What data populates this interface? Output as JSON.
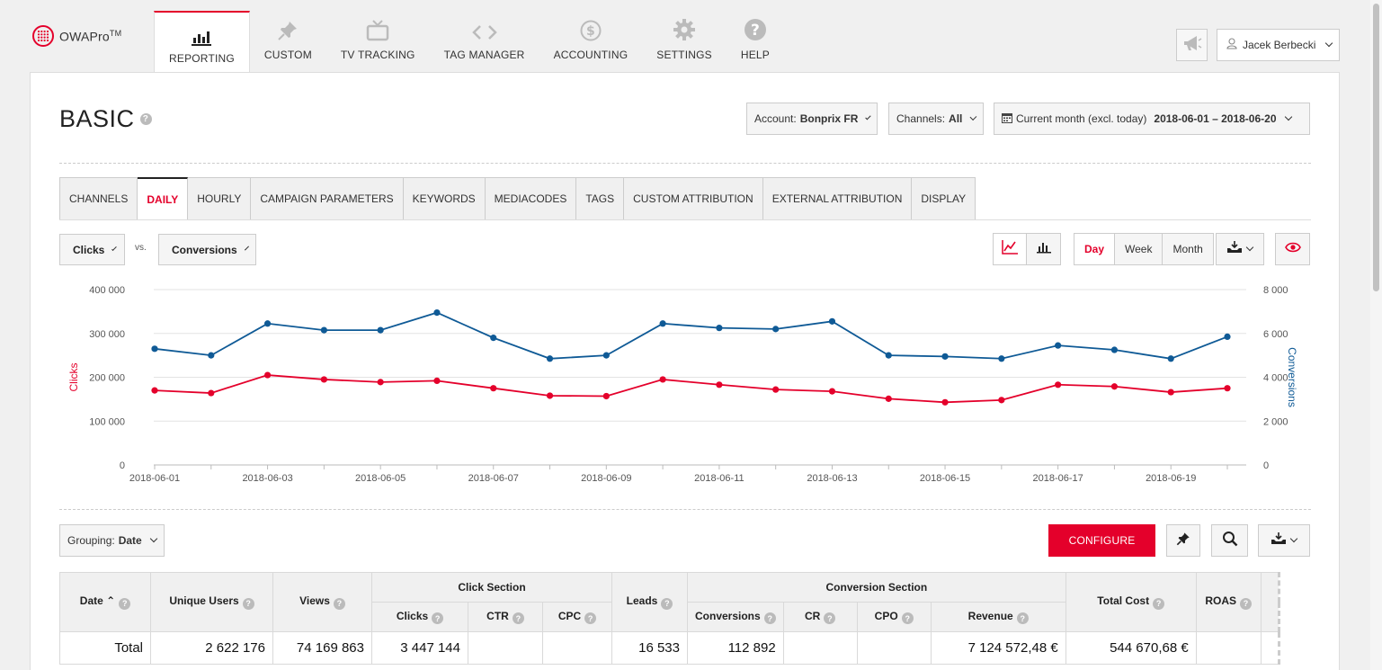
{
  "app": {
    "logo_text": "OWAPro",
    "logo_suffix": "TM"
  },
  "nav": [
    {
      "label": "REPORTING",
      "icon": "bar-chart-icon",
      "active": true
    },
    {
      "label": "CUSTOM",
      "icon": "pin-icon"
    },
    {
      "label": "TV TRACKING",
      "icon": "tv-icon"
    },
    {
      "label": "TAG MANAGER",
      "icon": "code-icon"
    },
    {
      "label": "ACCOUNTING",
      "icon": "dollar-icon"
    },
    {
      "label": "SETTINGS",
      "icon": "gear-icon"
    },
    {
      "label": "HELP",
      "icon": "question-icon"
    }
  ],
  "user": {
    "name": "Jacek Berbecki"
  },
  "page": {
    "title": "BASIC"
  },
  "filters": {
    "account_label": "Account:",
    "account_value": "Bonprix FR",
    "channels_label": "Channels:",
    "channels_value": "All",
    "date_label": "Current month (excl. today)",
    "date_value": "2018-06-01 – 2018-06-20"
  },
  "tabs": [
    "CHANNELS",
    "DAILY",
    "HOURLY",
    "CAMPAIGN PARAMETERS",
    "KEYWORDS",
    "MEDIACODES",
    "TAGS",
    "CUSTOM ATTRIBUTION",
    "EXTERNAL ATTRIBUTION",
    "DISPLAY"
  ],
  "active_tab": "DAILY",
  "metric_left": "Clicks",
  "vs_label": "vs.",
  "metric_right": "Conversions",
  "granularity": [
    "Day",
    "Week",
    "Month"
  ],
  "colors": {
    "accent": "#e4002b",
    "clicks": "#e4002b",
    "conversions": "#0f5a96"
  },
  "chart_data": {
    "type": "line",
    "x": [
      "2018-06-01",
      "2018-06-02",
      "2018-06-03",
      "2018-06-04",
      "2018-06-05",
      "2018-06-06",
      "2018-06-07",
      "2018-06-08",
      "2018-06-09",
      "2018-06-10",
      "2018-06-11",
      "2018-06-12",
      "2018-06-13",
      "2018-06-14",
      "2018-06-15",
      "2018-06-16",
      "2018-06-17",
      "2018-06-18",
      "2018-06-19",
      "2018-06-20"
    ],
    "x_tick_labels": [
      "2018-06-01",
      "2018-06-03",
      "2018-06-05",
      "2018-06-07",
      "2018-06-09",
      "2018-06-11",
      "2018-06-13",
      "2018-06-15",
      "2018-06-17",
      "2018-06-19"
    ],
    "series": [
      {
        "name": "Clicks",
        "axis": "left",
        "color": "#e4002b",
        "values": [
          170000,
          164000,
          205000,
          195000,
          189000,
          192000,
          175000,
          158000,
          157000,
          195000,
          183000,
          172000,
          168000,
          151000,
          143000,
          148000,
          183000,
          179000,
          166000,
          175000
        ]
      },
      {
        "name": "Conversions",
        "axis": "right",
        "color": "#0f5a96",
        "values": [
          5300,
          5000,
          6450,
          6150,
          6150,
          6950,
          5800,
          4850,
          5000,
          6450,
          6250,
          6200,
          6550,
          5000,
          4950,
          4850,
          5450,
          5250,
          4850,
          5850
        ]
      }
    ],
    "ylabel": "Clicks",
    "y2label": "Conversions",
    "ylim": [
      0,
      400000
    ],
    "y2lim": [
      0,
      8000
    ],
    "yticks": [
      "0",
      "100 000",
      "200 000",
      "300 000",
      "400 000"
    ],
    "y2ticks": [
      "0",
      "2 000",
      "4 000",
      "6 000",
      "8 000"
    ],
    "grid": true
  },
  "grouping": {
    "label": "Grouping:",
    "value": "Date"
  },
  "configure_label": "CONFIGURE",
  "table": {
    "headers": {
      "date": "Date",
      "unique_users": "Unique Users",
      "views": "Views",
      "click_section": "Click Section",
      "clicks": "Clicks",
      "ctr": "CTR",
      "cpc": "CPC",
      "leads": "Leads",
      "conversion_section": "Conversion Section",
      "conversions": "Conversions",
      "cr": "CR",
      "cpo": "CPO",
      "revenue": "Revenue",
      "total_cost": "Total Cost",
      "roas": "ROAS"
    },
    "total_row": {
      "label": "Total",
      "unique_users": "2 622 176",
      "views": "74 169 863",
      "clicks": "3 447 144",
      "ctr": "",
      "cpc": "",
      "leads": "16 533",
      "conversions": "112 892",
      "cr": "",
      "cpo": "",
      "revenue": "7 124 572,48 €",
      "total_cost": "544 670,68 €",
      "roas": ""
    }
  }
}
